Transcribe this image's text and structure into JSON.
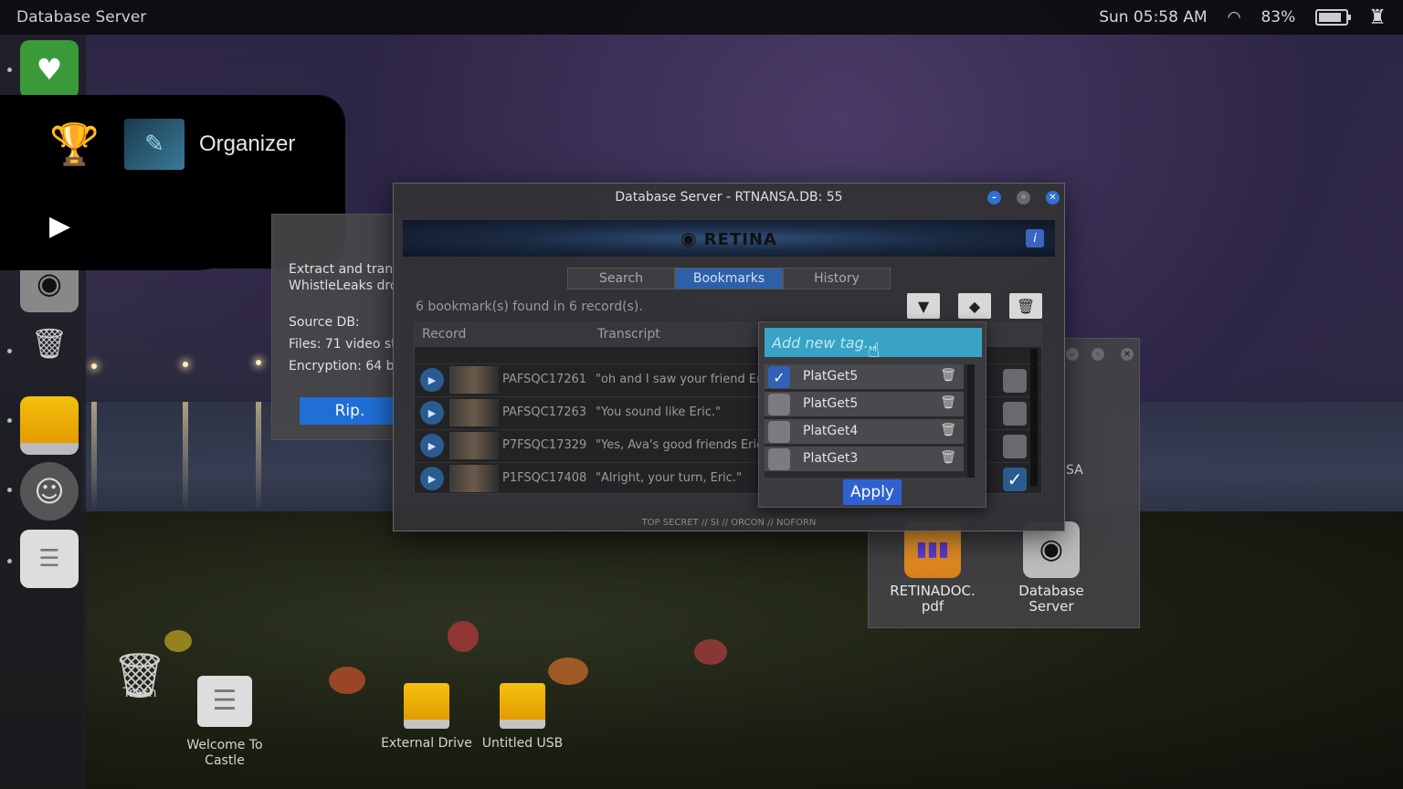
{
  "topbar": {
    "title": "Database Server",
    "clock": "Sun 05:58 AM",
    "battery_percent": "83%",
    "battery_level": 0.83
  },
  "organizer": {
    "label": "Organizer"
  },
  "background_window": {
    "lines": [
      "Extract and transm",
      "WhistleLeaks drop",
      "Source DB:",
      "Files: 71 video stre",
      "Encryption: 64 bas"
    ],
    "rip_label": "Rip."
  },
  "main_window": {
    "title": "Database Server - RTNANSA.DB: 55",
    "brand": "RETINA",
    "tabs": [
      "Search",
      "Bookmarks",
      "History"
    ],
    "active_tab": "Bookmarks",
    "found_text": "6 bookmark(s) found in 6 record(s).",
    "columns": {
      "record": "Record",
      "transcript": "Transcript"
    },
    "rows": [
      {
        "record": "PAFSQC17261",
        "transcript": "\"oh and I saw your friend Eric.\"",
        "checked": false
      },
      {
        "record": "PAFSQC17263",
        "transcript": "\"You sound like Eric.\"",
        "checked": false
      },
      {
        "record": "P7FSQC17329",
        "transcript": "\"Yes, Ava's good friends Eric an",
        "checked": false
      },
      {
        "record": "P1FSQC17408",
        "transcript": "\"Alright, your turn, Eric.\"",
        "checked": true
      }
    ],
    "classification": "TOP SECRET // SI // ORCON // NOFORN"
  },
  "tag_popup": {
    "placeholder": "Add new tag...",
    "tags": [
      {
        "label": "PlatGet5",
        "checked": true
      },
      {
        "label": "PlatGet5",
        "checked": false
      },
      {
        "label": "PlatGet4",
        "checked": false
      },
      {
        "label": "PlatGet3",
        "checked": false
      }
    ],
    "apply_label": "Apply"
  },
  "right_window": {
    "partial_label": "SA",
    "items": [
      {
        "label_line1": "RETINADOC.",
        "label_line2": "pdf"
      },
      {
        "label_line1": "Database",
        "label_line2": "Server"
      }
    ]
  },
  "desktop": {
    "trash": "Trash",
    "welcome_line1": "Welcome To",
    "welcome_line2": "Castle",
    "external_drive": "External Drive",
    "untitled_usb": "Untitled USB"
  },
  "colors": {
    "accent": "#2f62b8",
    "input": "#38a3c4",
    "drive": "#f3c20c"
  }
}
